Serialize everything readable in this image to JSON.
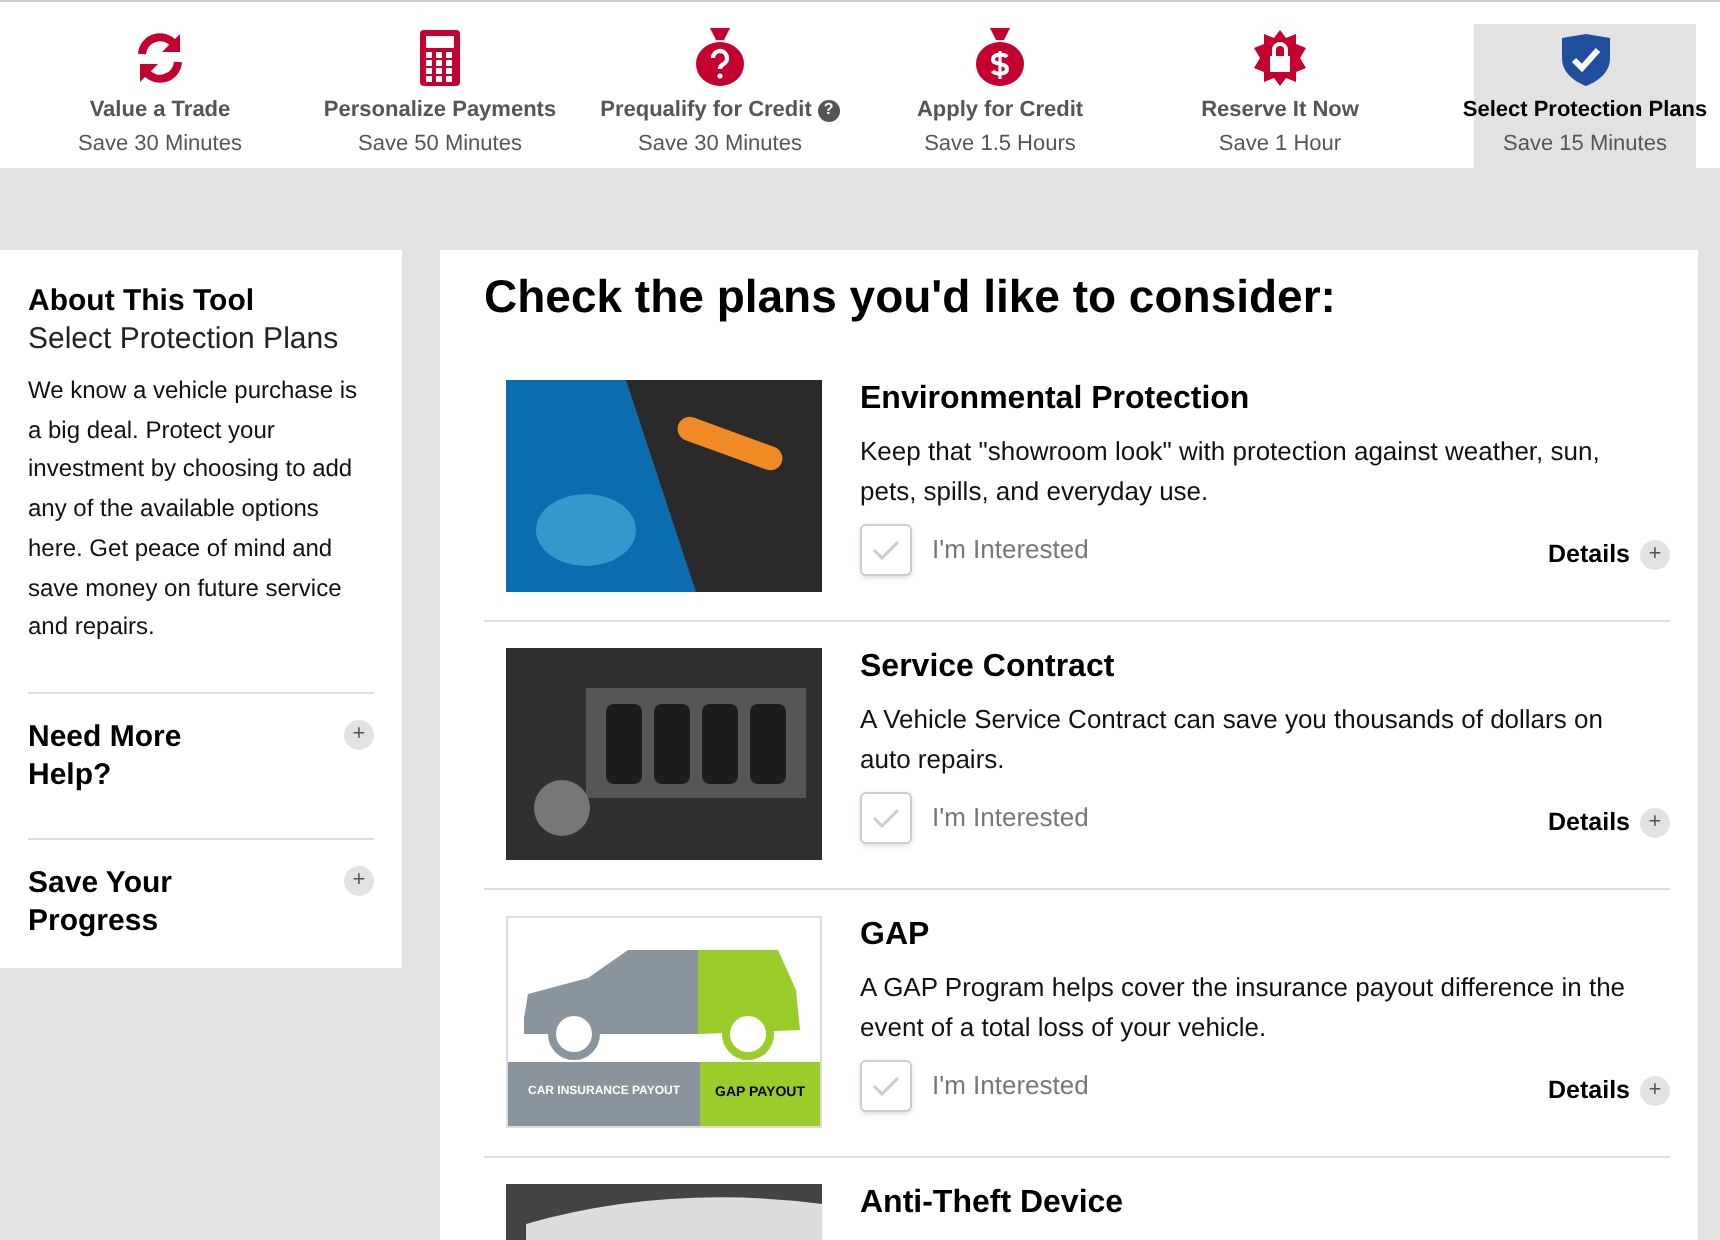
{
  "steps": [
    {
      "label": "Value a Trade",
      "time": "Save 30 Minutes",
      "selected": false
    },
    {
      "label": "Personalize Payments",
      "time": "Save 50 Minutes",
      "selected": false
    },
    {
      "label": "Prequalify for Credit",
      "time": "Save 30 Minutes",
      "selected": false,
      "help": "?"
    },
    {
      "label": "Apply for Credit",
      "time": "Save 1.5 Hours",
      "selected": false
    },
    {
      "label": "Reserve It Now",
      "time": "Save 1 Hour",
      "selected": false
    },
    {
      "label": "Select Protection Plans",
      "time": "Save 15 Minutes",
      "selected": true
    }
  ],
  "sidebar": {
    "heading": "About This Tool",
    "subheading": "Select Protection Plans",
    "body": "We know a vehicle purchase is a big deal. Protect your investment by choosing to add any of the available options here. Get peace of mind and save money on future service and repairs.",
    "sections": [
      {
        "label": "Need More Help?",
        "toggle": "+"
      },
      {
        "label": "Save Your Progress",
        "toggle": "+"
      }
    ]
  },
  "main": {
    "heading": "Check the plans you'd like to consider:",
    "plans": [
      {
        "kind": "interior",
        "title": "Environmental Protection",
        "description": "Keep that \"showroom look\" with protection against weather, sun, pets, spills, and everyday use.",
        "checkbox_label": "I'm Interested",
        "checked": false,
        "details": "Details",
        "details_toggle": "+"
      },
      {
        "kind": "engine",
        "title": "Service Contract",
        "description": "A Vehicle Service Contract can save you thousands of dollars on auto repairs.",
        "checkbox_label": "I'm Interested",
        "checked": false,
        "details": "Details",
        "details_toggle": "+"
      },
      {
        "kind": "gap",
        "title": "GAP",
        "description": "A GAP Program helps cover the insurance payout difference in the event of a total loss of your vehicle.",
        "checkbox_label": "I'm Interested",
        "checked": false,
        "details": "Details",
        "details_toggle": "+",
        "image_labels": [
          "CAR INSURANCE PAYOUT",
          "GAP PAYOUT"
        ]
      },
      {
        "kind": "door",
        "title": "Anti-Theft Device"
      }
    ]
  }
}
